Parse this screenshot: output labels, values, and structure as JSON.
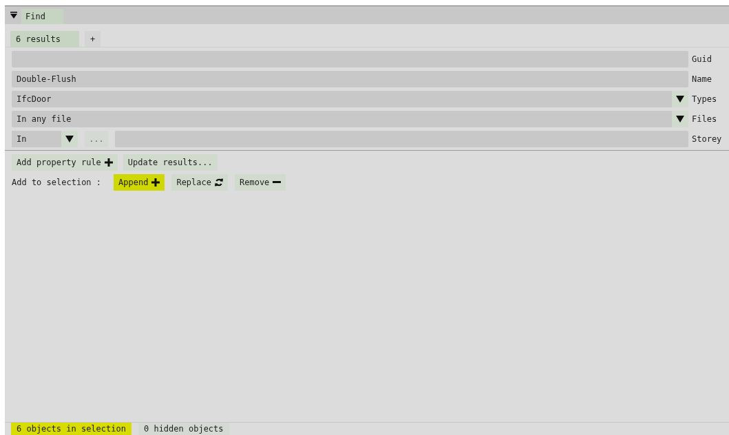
{
  "window": {
    "title": "Find"
  },
  "tabs": [
    {
      "label": "6 results",
      "selected": true
    },
    {
      "label": "+",
      "selected": false
    }
  ],
  "fields": [
    {
      "kind": "text",
      "label": "Guid"
    },
    {
      "kind": "text",
      "value": "Double-Flush",
      "label": "Name"
    },
    {
      "kind": "dropdown",
      "value": "IfcDoor",
      "label": "Types"
    },
    {
      "kind": "dropdown",
      "value": "In any file",
      "label": "Files"
    },
    {
      "kind": "storey",
      "operator": "In",
      "more": "...",
      "label": "Storey"
    }
  ],
  "actions": [
    {
      "label": "Add property rule",
      "kind": "add"
    },
    {
      "label": "Update results...",
      "kind": "plain"
    }
  ],
  "selection_mode": {
    "label": "Add to selection :",
    "options": [
      {
        "label": "Append",
        "kind": "append",
        "selected": true
      },
      {
        "label": "Replace",
        "kind": "replace",
        "selected": false
      },
      {
        "label": "Remove",
        "kind": "remove",
        "selected": false
      }
    ]
  },
  "status_bar": [
    {
      "label": "6 objects in selection",
      "selected": true
    },
    {
      "label": "0 hidden objects",
      "selected": false
    }
  ]
}
